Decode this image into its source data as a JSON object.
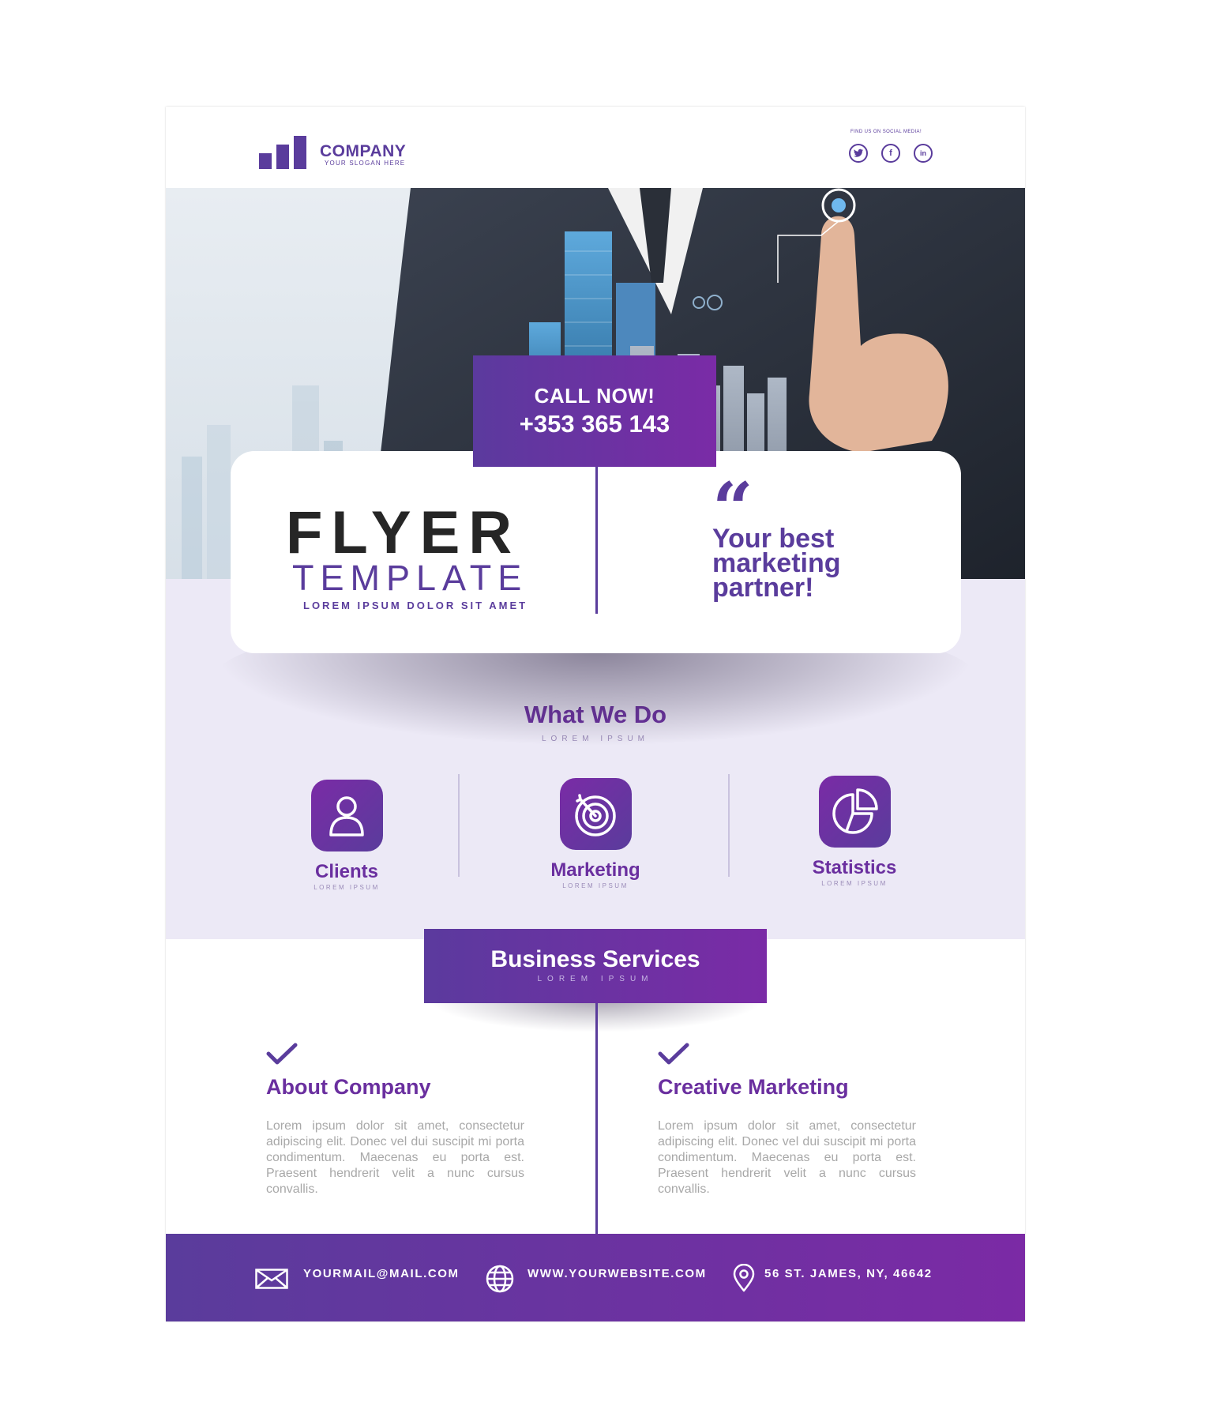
{
  "header": {
    "company_name": "COMPANY",
    "slogan": "YOUR SLOGAN HERE",
    "social_label": "FIND US ON SOCIAL MEDIA!",
    "social": [
      {
        "icon": "twitter-icon"
      },
      {
        "icon": "facebook-icon",
        "glyph": "f"
      },
      {
        "icon": "linkedin-icon",
        "glyph": "in"
      }
    ]
  },
  "call": {
    "label": "CALL NOW!",
    "number": "+353 365 143"
  },
  "hero_card": {
    "title": "FLYER",
    "subtitle": "TEMPLATE",
    "tagline": "LOREM IPSUM DOLOR SIT AMET",
    "quote_mark": "“",
    "quote": "Your best marketing partner!"
  },
  "what_we_do": {
    "title": "What We Do",
    "subtitle": "LOREM IPSUM",
    "items": [
      {
        "label": "Clients",
        "sub": "LOREM IPSUM",
        "icon": "user-icon"
      },
      {
        "label": "Marketing",
        "sub": "LOREM IPSUM",
        "icon": "target-icon"
      },
      {
        "label": "Statistics",
        "sub": "LOREM IPSUM",
        "icon": "pie-chart-icon"
      }
    ]
  },
  "business_services": {
    "title": "Business Services",
    "subtitle": "LOREM IPSUM",
    "columns": [
      {
        "title": "About Company",
        "text": "Lorem ipsum dolor sit amet, consectetur adipiscing elit. Donec vel dui suscipit mi porta condimentum. Maecenas eu porta est. Praesent hendrerit velit a nunc cursus convallis."
      },
      {
        "title": "Creative Marketing",
        "text": "Lorem ipsum dolor sit amet, consectetur adipiscing elit. Donec vel dui suscipit mi porta condimentum. Maecenas eu porta est. Praesent hendrerit velit a nunc cursus convallis."
      }
    ]
  },
  "footer": {
    "email": "YOURMAIL@MAIL.COM",
    "website": "WWW.YOURWEBSITE.COM",
    "address": "56 ST. JAMES, NY, 46642"
  },
  "colors": {
    "brand_purple": "#5a3c9c",
    "accent_magenta": "#7a2ba6",
    "lavender_bg": "#ece9f6",
    "body_text": "#a8a8a8"
  }
}
